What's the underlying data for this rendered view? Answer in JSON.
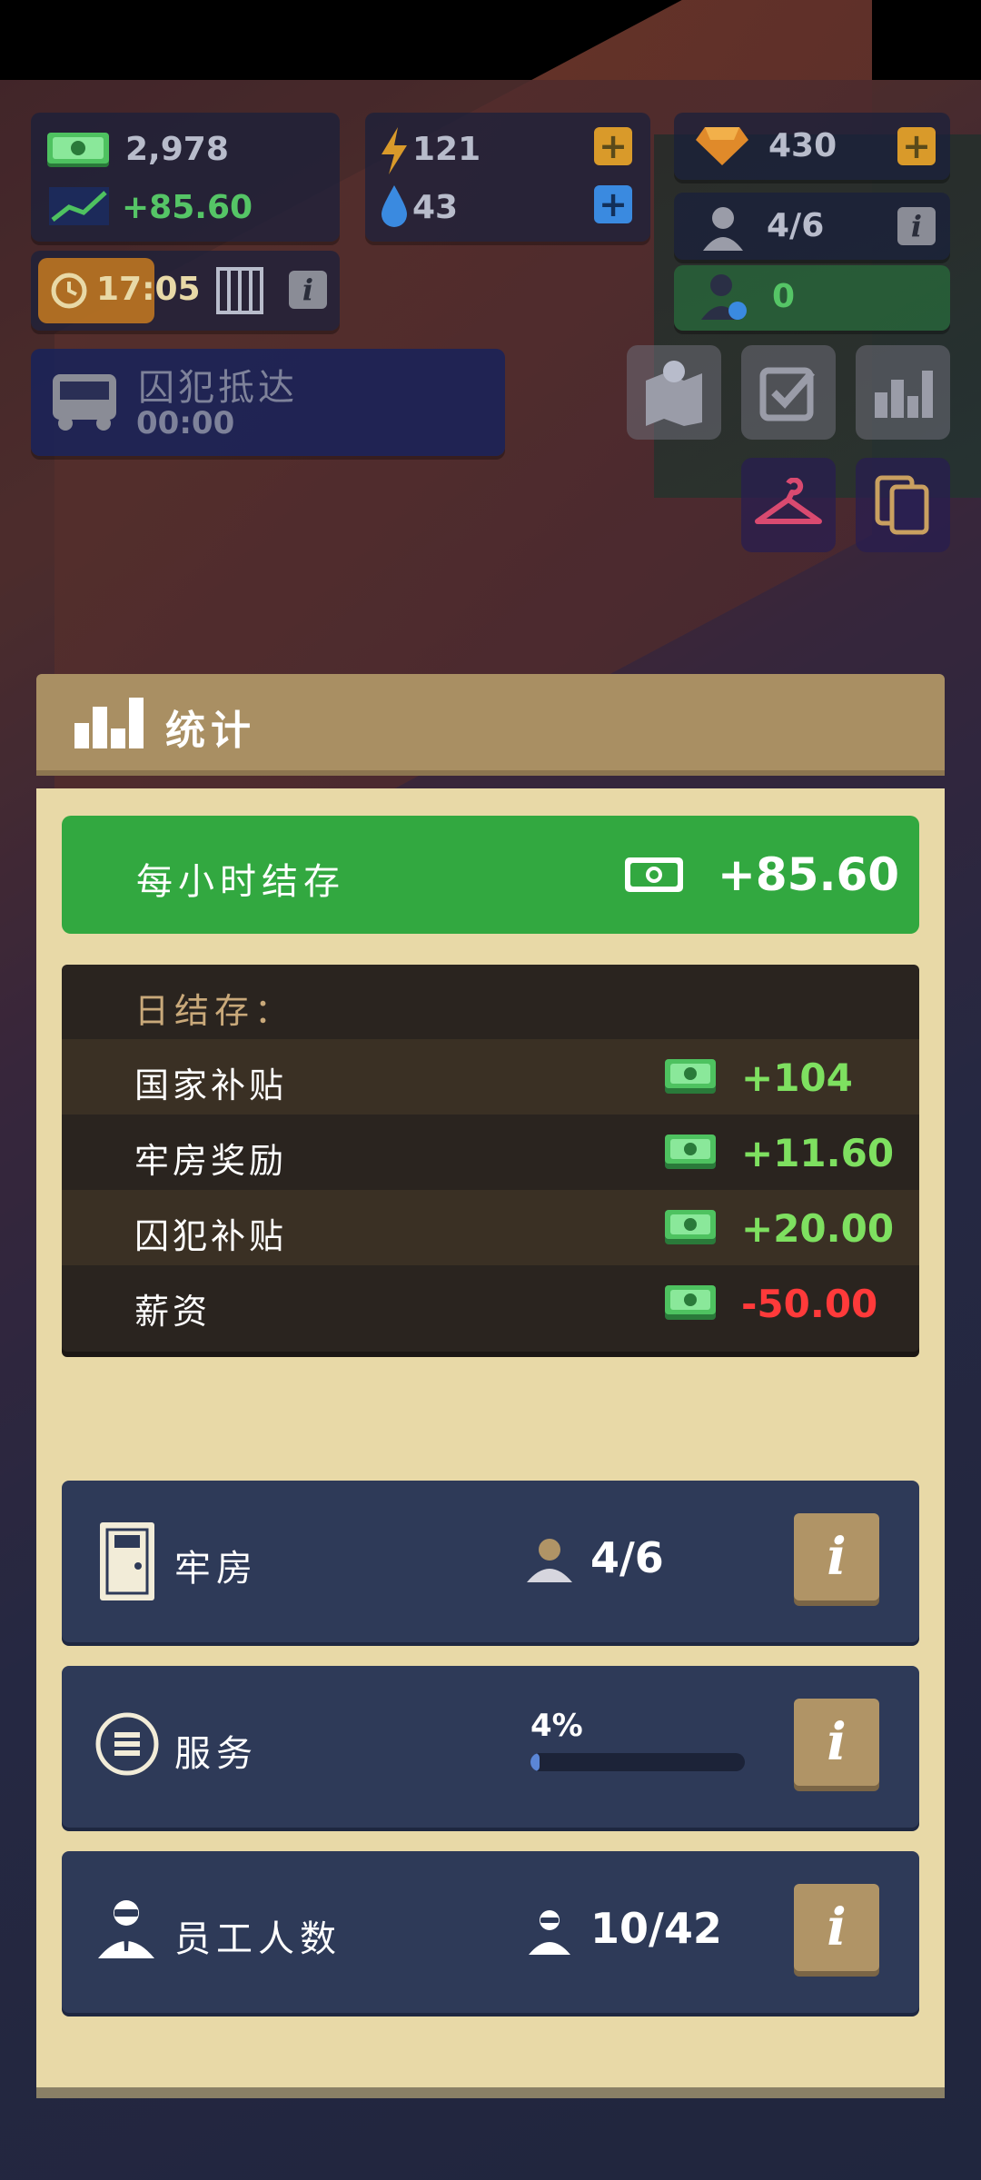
{
  "hud": {
    "money": "2,978",
    "money_rate": "+85.60",
    "energy": "121",
    "water": "43",
    "gems": "430",
    "prisoners": "4/6",
    "staff_ready": "0",
    "time": "17:05",
    "arrival_label": "囚犯抵达",
    "arrival_timer": "00:00"
  },
  "stats": {
    "title": "统计",
    "hourly_label": "每小时结存",
    "hourly_value": "+85.60",
    "daily_label": "日结存：",
    "daily_items": [
      {
        "label": "国家补贴",
        "value": "+104",
        "color": "#7ee060"
      },
      {
        "label": "牢房奖励",
        "value": "+11.60",
        "color": "#7ee060"
      },
      {
        "label": "囚犯补贴",
        "value": "+20.00",
        "color": "#7ee060"
      },
      {
        "label": "薪资",
        "value": "-50.00",
        "color": "#ff3a3a"
      }
    ],
    "cells_label": "牢房",
    "cells_count": "4/6",
    "service_label": "服务",
    "service_percent_text": "4%",
    "service_percent": 4,
    "staff_label": "员工人数",
    "staff_count": "10/42",
    "info_glyph": "i"
  },
  "colors": {
    "green_positive": "#7ee060",
    "red_negative": "#ff3a3a",
    "header_gold": "#a98f63",
    "card_navy": "#2e3a58"
  }
}
